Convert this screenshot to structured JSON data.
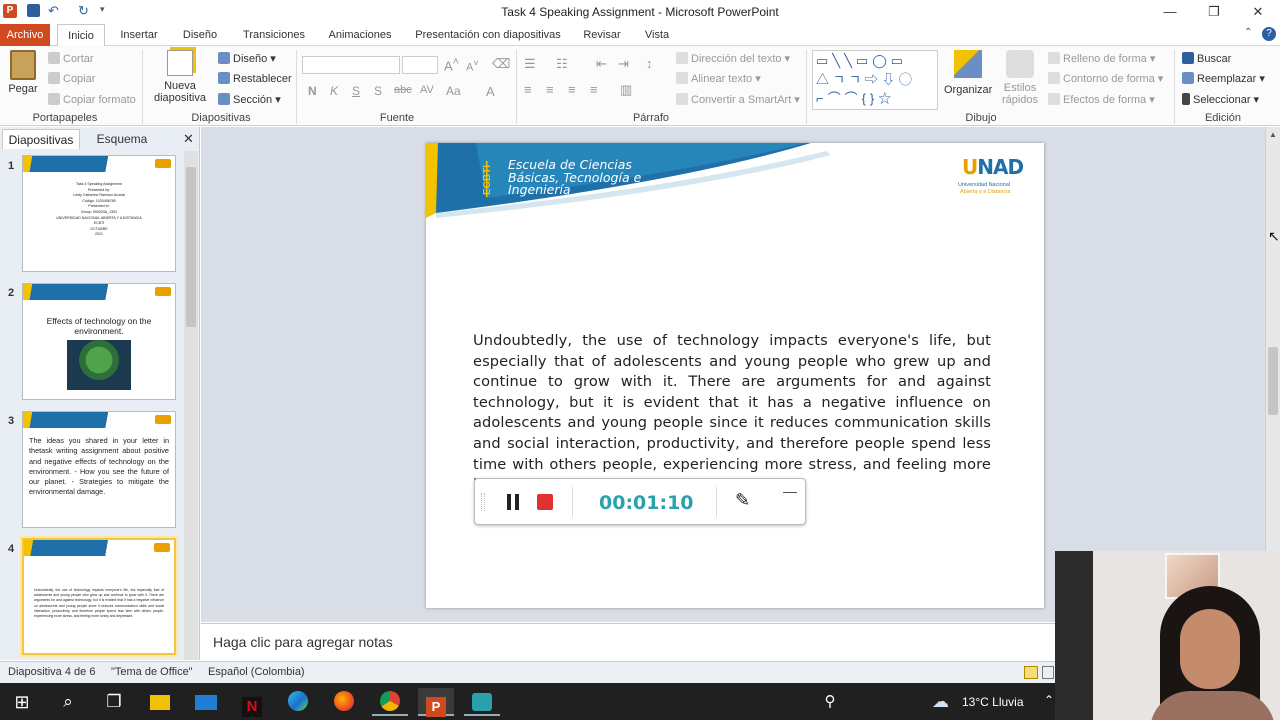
{
  "window": {
    "title": "Task 4 Speaking Assignment  -  Microsoft PowerPoint"
  },
  "tabs": [
    "Archivo",
    "Inicio",
    "Insertar",
    "Diseño",
    "Transiciones",
    "Animaciones",
    "Presentación con diapositivas",
    "Revisar",
    "Vista"
  ],
  "ribbon": {
    "portapapeles": {
      "label": "Portapapeles",
      "pegar": "Pegar",
      "cortar": "Cortar",
      "copiar": "Copiar",
      "copiar_formato": "Copiar formato"
    },
    "diapositivas": {
      "label": "Diapositivas",
      "nueva": "Nueva",
      "nueva2": "diapositiva",
      "diseno": "Diseño",
      "restablecer": "Restablecer",
      "seccion": "Sección"
    },
    "fuente": {
      "label": "Fuente"
    },
    "parrafo": {
      "label": "Párrafo",
      "direccion": "Dirección del texto",
      "alinear": "Alinear texto",
      "smartart": "Convertir a SmartArt"
    },
    "dibujo": {
      "label": "Dibujo",
      "organizar": "Organizar",
      "estilos": "Estilos",
      "estilos2": "rápidos",
      "relleno": "Relleno de forma",
      "contorno": "Contorno de forma",
      "efectos": "Efectos de forma"
    },
    "edicion": {
      "label": "Edición",
      "buscar": "Buscar",
      "reemplazar": "Reemplazar",
      "seleccionar": "Seleccionar"
    }
  },
  "panel": {
    "tab_slides": "Diapositivas",
    "tab_outline": "Esquema"
  },
  "thumbnails": [
    {
      "num": "1",
      "lines": [
        "Task 4 Speaking Assignment",
        "Presented by:",
        "Leidy Catherine Ramírez Acosta",
        "Código: 1030456789",
        "Presented to:",
        "Group: 900003A_1392",
        "UNIVERSIDAD NACIONAL ABIERTA Y A DISTANCIA",
        "ECBTI",
        "OCTUBRE",
        "2021"
      ]
    },
    {
      "num": "2",
      "lines": [
        "Effects of technology on the",
        "environment."
      ]
    },
    {
      "num": "3",
      "lines": [
        "The ideas you shared in your letter in thetask writing assignment about positive and negative effects of technology on the environment. - How you see the future of our planet. - Strategies to mitigate the environmental damage."
      ]
    },
    {
      "num": "4",
      "lines": [
        "Undoubtedly, the use of technology impacts everyone's life, but especially that of adolescents and young people who grew up and continue to grow with it."
      ]
    }
  ],
  "slide": {
    "banner_line1": "Escuela de Ciencias",
    "banner_line2": "Básicas, Tecnología e",
    "banner_line3": "Ingeniería",
    "banner_acronym": "ECBTI",
    "logo_line1": "Universidad Nacional",
    "logo_line2": "Abierta y a Distancia",
    "body": "Undoubtedly, the use of technology impacts everyone's life, but especially that of adolescents and young people who grew up and continue to grow with it. There are arguments for and against technology, but it is evident that it has a negative influence on adolescents and young people since it reduces communication skills and social interaction, productivity, and therefore people spend less time with others people, experiencing more stress, and feeling more lonely and depressed."
  },
  "recorder": {
    "timer": "00:01:10"
  },
  "notes": {
    "placeholder": "Haga clic para agregar notas"
  },
  "status": {
    "slide": "Diapositiva 4 de 6",
    "theme": "\"Tema de Office\"",
    "language": "Español (Colombia)"
  },
  "taskbar": {
    "weather": "13°C  Lluvia"
  },
  "colors": {
    "archivo": "#d04a20",
    "timer": "#2aa1ad",
    "banner_blue": "#1f6fa8",
    "banner_yellow": "#f2c200"
  }
}
